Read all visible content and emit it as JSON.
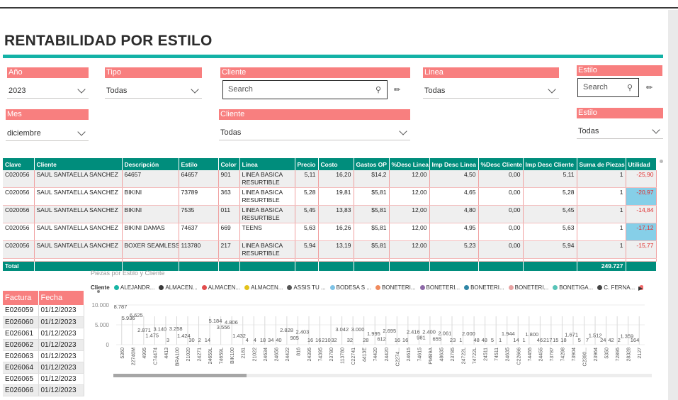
{
  "page": {
    "title": "RENTABILIDAD POR ESTILO"
  },
  "slicers": {
    "anio": {
      "label": "Año",
      "value": "2023"
    },
    "tipo": {
      "label": "Tipo",
      "value": "Todas"
    },
    "cliente_search": {
      "label": "Cliente",
      "placeholder": "Search"
    },
    "linea": {
      "label": "Linea",
      "value": "Todas"
    },
    "estilo_search": {
      "label": "Estilo",
      "placeholder": "Search"
    },
    "mes": {
      "label": "Mes",
      "value": "diciembre"
    },
    "cliente": {
      "label": "Cliente",
      "value": "Todas"
    },
    "estilo": {
      "label": "Estilo",
      "value": "Todas"
    }
  },
  "table": {
    "columns": [
      "Clave",
      "Cliente",
      "Descripción",
      "Estilo",
      "Color",
      "Linea",
      "Precio",
      "Costo",
      "Gastos OP",
      "%Desc Linea",
      "Imp Desc Linea",
      "%Desc Cliente",
      "Imp Desc Cliente",
      "Suma de Piezas",
      "Utilidad"
    ],
    "rows": [
      [
        "C020056",
        "SAUL SANTAELLA SANCHEZ",
        "64657",
        "64657",
        "901",
        "LINEA BASICA RESURTIBLE",
        "5,11",
        "16,20",
        "$14,2",
        "12,00",
        "4,50",
        "0,00",
        "5,11",
        "1",
        "-25,90"
      ],
      [
        "C020056",
        "SAUL SANTAELLA SANCHEZ",
        "BIKINI",
        "73789",
        "363",
        "LINEA BASICA RESURTIBLE",
        "5,28",
        "19,81",
        "$5,81",
        "12,00",
        "4,65",
        "0,00",
        "5,28",
        "1",
        "-20,97"
      ],
      [
        "C020056",
        "SAUL SANTAELLA SANCHEZ",
        "BIKINI",
        "7535",
        "011",
        "LINEA BASICA RESURTIBLE",
        "5,45",
        "13,83",
        "$5,81",
        "12,00",
        "4,80",
        "0,00",
        "5,45",
        "1",
        "-14,84"
      ],
      [
        "C020056",
        "SAUL SANTAELLA SANCHEZ",
        "BIKINI DAMAS",
        "74637",
        "669",
        "TEENS",
        "5,63",
        "16,26",
        "$5,81",
        "12,00",
        "4,95",
        "0,00",
        "5,63",
        "1",
        "-17,12"
      ],
      [
        "C020056",
        "SAUL SANTAELLA SANCHEZ",
        "BOXER SEAMLESS",
        "113780",
        "217",
        "LINEA BASICA RESURTIBLE",
        "5,94",
        "13,19",
        "$5,81",
        "12,00",
        "5,23",
        "0,00",
        "5,94",
        "1",
        "-15,77"
      ]
    ],
    "total_label": "Total",
    "total_piezas": "249.727"
  },
  "facturas": {
    "columns": [
      "Factura",
      "Fecha"
    ],
    "rows": [
      [
        "E026059",
        "01/12/2023"
      ],
      [
        "E026060",
        "01/12/2023"
      ],
      [
        "E026061",
        "01/12/2023"
      ],
      [
        "E026062",
        "01/12/2023"
      ],
      [
        "E026063",
        "01/12/2023"
      ],
      [
        "E026064",
        "01/12/2023"
      ],
      [
        "E026065",
        "01/12/2023"
      ],
      [
        "E026066",
        "01/12/2023"
      ]
    ]
  },
  "chart_data": {
    "type": "bar",
    "title": "Piezas por Estilo y Cliente",
    "legend": {
      "title": "Cliente",
      "items": [
        {
          "name": "ALEJANDR...",
          "color": "#18b5a5"
        },
        {
          "name": "ALMACEN...",
          "color": "#3a3a3a"
        },
        {
          "name": "ALMACEN...",
          "color": "#e24e4e"
        },
        {
          "name": "ALMACEN...",
          "color": "#e3c21a"
        },
        {
          "name": "ASSIS TU ...",
          "color": "#555555"
        },
        {
          "name": "BODESA S ...",
          "color": "#7ec3e6"
        },
        {
          "name": "BONETERI...",
          "color": "#f08a5d"
        },
        {
          "name": "BONETERI...",
          "color": "#8e6aa8"
        },
        {
          "name": "BONETERI...",
          "color": "#2f86a6"
        },
        {
          "name": "BONETERI...",
          "color": "#e8a3a3"
        },
        {
          "name": "BONETIGA...",
          "color": "#57c4b8"
        },
        {
          "name": "C. FERNA...",
          "color": "#444444"
        },
        {
          "name": "CASA LEY, ...",
          "color": "#f06c6c"
        }
      ]
    },
    "y_ticks": [
      "10.000",
      "5.000",
      "0"
    ],
    "ylim": [
      0,
      10000
    ],
    "categories": [
      "5360",
      "22740M",
      "4995",
      "C74474",
      "4413",
      "BRA100",
      "21020",
      "24271",
      "24659L",
      "74659L",
      "BIK100",
      "2181",
      "21022",
      "24634",
      "24656",
      "24422",
      "816",
      "24395",
      "74395",
      "23780",
      "113780",
      "C22741",
      "4413E",
      "74420",
      "24420",
      "C2274...",
      "24615",
      "74615",
      "PMB9A",
      "48635",
      "23785",
      "24722L",
      "74722L",
      "24511",
      "74511",
      "24635",
      "C22666",
      "74455",
      "24455",
      "73787",
      "74298",
      "73904",
      "C2390...",
      "23964",
      "5350",
      "72895",
      "28328",
      "2127"
    ],
    "data_labels": [
      "8.787",
      "5.936",
      "6.625",
      "2.871",
      "1.475",
      "3.140",
      "3",
      "3.258",
      "1.424",
      "30",
      "2",
      "14",
      "5.184",
      "3.556",
      "4.806",
      "1.432",
      "4",
      "4",
      "18",
      "34",
      "40",
      "2.828",
      "905",
      "2.403",
      "16",
      "16",
      "210",
      "32",
      "3.042",
      "32",
      "3.000",
      "28",
      "1.995",
      "612",
      "2.695",
      "16",
      "16",
      "2.416",
      "981",
      "2.400",
      "655",
      "2.061",
      "23",
      "1",
      "2.000",
      "48",
      "48",
      "5",
      "1",
      "1.944",
      "14",
      "1",
      "1.800",
      "46",
      "217",
      "15",
      "18",
      "1.671",
      "5",
      "7",
      "1.512",
      "24",
      "42",
      "2",
      "1.359",
      "164"
    ]
  }
}
